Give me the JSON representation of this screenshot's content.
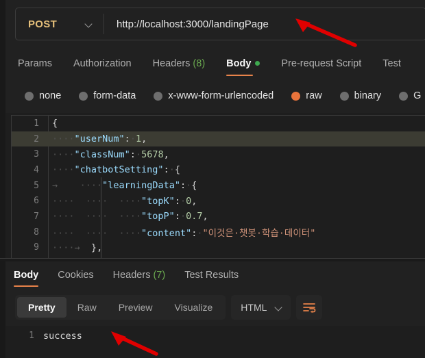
{
  "request_bar": {
    "method": "POST",
    "method_chevron_icon": "chevron-down-icon",
    "url": "http://localhost:3000/landingPage"
  },
  "request_tabs": [
    {
      "label": "Params",
      "count": "",
      "active": false,
      "has_dot": false
    },
    {
      "label": "Authorization",
      "count": "",
      "active": false,
      "has_dot": false
    },
    {
      "label": "Headers",
      "count": "(8)",
      "active": false,
      "has_dot": false
    },
    {
      "label": "Body",
      "count": "",
      "active": true,
      "has_dot": true
    },
    {
      "label": "Pre-request Script",
      "count": "",
      "active": false,
      "has_dot": false
    },
    {
      "label": "Test",
      "count": "",
      "active": false,
      "has_dot": false
    }
  ],
  "body_types": [
    {
      "label": "none",
      "selected": false
    },
    {
      "label": "form-data",
      "selected": false
    },
    {
      "label": "x-www-form-urlencoded",
      "selected": false
    },
    {
      "label": "raw",
      "selected": true
    },
    {
      "label": "binary",
      "selected": false
    },
    {
      "label": "G",
      "selected": false
    }
  ],
  "editor": {
    "lines": [
      {
        "num": "1",
        "active": false
      },
      {
        "num": "2",
        "active": true
      },
      {
        "num": "3",
        "active": false
      },
      {
        "num": "4",
        "active": false
      },
      {
        "num": "5",
        "active": false
      },
      {
        "num": "6",
        "active": false
      },
      {
        "num": "7",
        "active": false
      },
      {
        "num": "8",
        "active": false
      },
      {
        "num": "9",
        "active": false
      }
    ],
    "code": {
      "l1_open_brace": "{",
      "l2_ws": "····",
      "l2_key": "\"userNum\"",
      "l2_colon": ":",
      "l2_mid": "·",
      "l2_val": "1",
      "l2_comma": ",",
      "l3_ws": "····",
      "l3_key": "\"classNum\"",
      "l3_colon": ":",
      "l3_mid": "·",
      "l3_val": "5678",
      "l3_comma": ",",
      "l4_ws": "····",
      "l4_key": "\"chatbotSetting\"",
      "l4_colon": ":",
      "l4_mid": "·",
      "l4_brace": "{",
      "l5_arrow": "→",
      "l5_ws": "····",
      "l5_key": "\"learningData\"",
      "l5_colon": ":",
      "l5_mid": "·",
      "l5_brace": "{",
      "l6_ws": "····  ····  ····",
      "l6_key": "\"topK\"",
      "l6_colon": ":",
      "l6_mid": "·",
      "l6_val": "0",
      "l6_comma": ",",
      "l7_ws": "····  ····  ····",
      "l7_key": "\"topP\"",
      "l7_colon": ":",
      "l7_mid": "·",
      "l7_val": "0.7",
      "l7_comma": ",",
      "l8_ws": "····  ····  ····",
      "l8_key": "\"content\"",
      "l8_colon": ":",
      "l8_mid": "·",
      "l8_val": "\"이것은·챗봇·학습·데이터\"",
      "l9_ws": "····",
      "l9_arrow": "→",
      "l9_brace": "}",
      "l9_comma": ","
    }
  },
  "response_tabs": [
    {
      "label": "Body",
      "count": "",
      "active": true
    },
    {
      "label": "Cookies",
      "count": "",
      "active": false
    },
    {
      "label": "Headers",
      "count": "(7)",
      "active": false
    },
    {
      "label": "Test Results",
      "count": "",
      "active": false
    }
  ],
  "view_toolbar": {
    "segments": [
      {
        "label": "Pretty",
        "active": true
      },
      {
        "label": "Raw",
        "active": false
      },
      {
        "label": "Preview",
        "active": false
      },
      {
        "label": "Visualize",
        "active": false
      }
    ],
    "format": "HTML",
    "format_chevron_icon": "chevron-down-icon",
    "wrap_icon": "wrap-lines-icon"
  },
  "response_body": {
    "line_number": "1",
    "text": "success"
  },
  "annotations": {
    "arrow_color": "#e00000",
    "url_arrow": "arrow-pointing-to-url",
    "success_arrow": "arrow-pointing-to-success"
  },
  "colors": {
    "accent_orange": "#e8834a",
    "method_yellow": "#e6c07b",
    "count_green": "#6aa84f",
    "json_key": "#9cdcfe",
    "json_number": "#b5cea8",
    "json_string": "#ce9178"
  }
}
